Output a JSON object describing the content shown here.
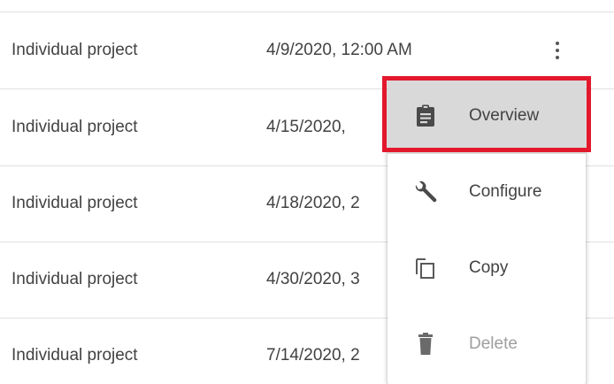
{
  "rows": [
    {
      "type": "Individual project",
      "date": "4/9/2020, 12:00 AM"
    },
    {
      "type": "Individual project",
      "date": "4/15/2020,"
    },
    {
      "type": "Individual project",
      "date": "4/18/2020, 2"
    },
    {
      "type": "Individual project",
      "date": "4/30/2020, 3"
    },
    {
      "type": "Individual project",
      "date": "7/14/2020, 2"
    }
  ],
  "context_menu": {
    "items": [
      {
        "label": "Overview",
        "icon": "clipboard-icon",
        "state": "highlighted"
      },
      {
        "label": "Configure",
        "icon": "wrench-icon",
        "state": "enabled"
      },
      {
        "label": "Copy",
        "icon": "copy-icon",
        "state": "enabled"
      },
      {
        "label": "Delete",
        "icon": "trash-icon",
        "state": "disabled"
      }
    ]
  },
  "colors": {
    "highlight_frame": "#e3182d",
    "highlight_bg": "#d9d9d9",
    "text": "#424242",
    "disabled_text": "#9e9e9e",
    "divider": "#e0e0e0"
  }
}
